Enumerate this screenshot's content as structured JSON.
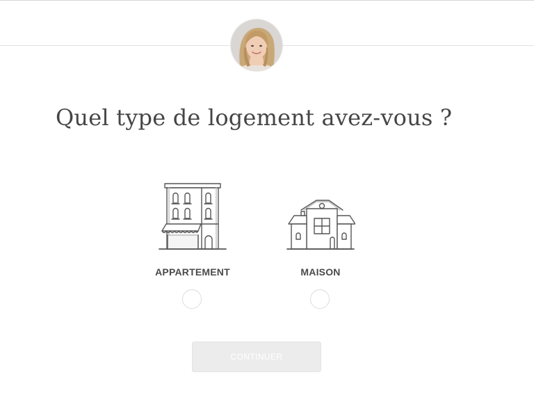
{
  "header": {
    "avatar_icon": "advisor-avatar"
  },
  "main": {
    "question": "Quel type de logement avez-vous ?",
    "options": [
      {
        "label": "APPARTEMENT",
        "icon": "apartment-building-icon",
        "selected": false
      },
      {
        "label": "MAISON",
        "icon": "house-icon",
        "selected": false
      }
    ],
    "continue_label": "CONTINUER"
  },
  "colors": {
    "text": "#454545",
    "line_art": "#555555",
    "button_disabled_bg": "#ececec",
    "radio_border": "#dcdcdc"
  }
}
